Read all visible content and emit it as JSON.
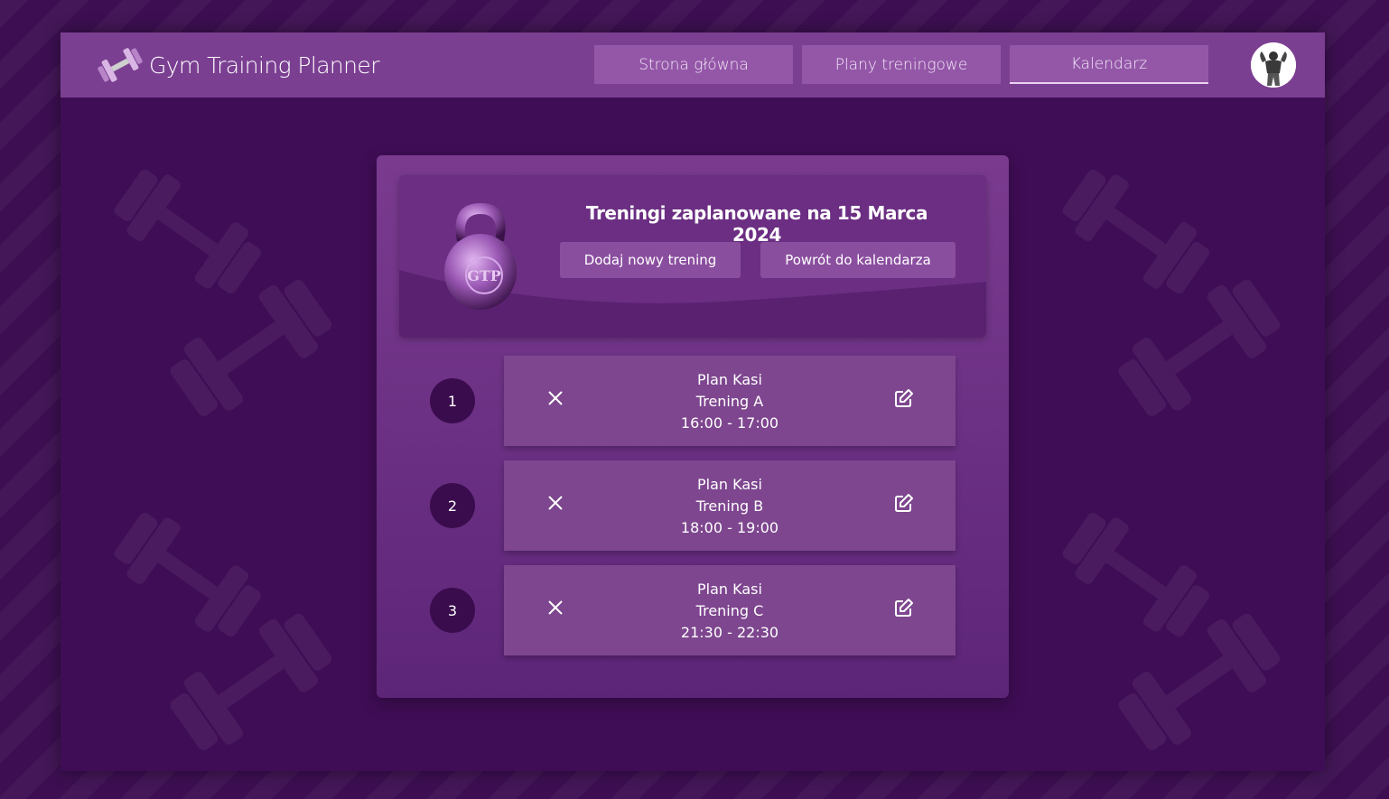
{
  "app": {
    "title": "Gym Training Planner",
    "logo_icon": "dumbbell-icon",
    "avatar_icon": "bodybuilder-avatar-icon"
  },
  "nav": {
    "items": [
      {
        "label": "Strona główna",
        "active": false
      },
      {
        "label": "Plany treningowe",
        "active": false
      },
      {
        "label": "Kalendarz",
        "active": true
      }
    ]
  },
  "day": {
    "title": "Treningi zaplanowane na 15 Marca 2024",
    "add_label": "Dodaj nowy trening",
    "back_label": "Powrót do kalendarza",
    "badge_icon": "kettlebell-gtp-icon",
    "badge_text": "GTP"
  },
  "trainings": [
    {
      "number": "1",
      "plan": "Plan Kasi",
      "name": "Trening A",
      "time": "16:00 - 17:00"
    },
    {
      "number": "2",
      "plan": "Plan Kasi",
      "name": "Trening B",
      "time": "18:00 - 19:00"
    },
    {
      "number": "3",
      "plan": "Plan Kasi",
      "name": "Trening C",
      "time": "21:30 - 22:30"
    }
  ],
  "colors": {
    "background": "#3d0f52",
    "header": "#7b3f92",
    "nav_button": "#9457a8",
    "panel": "#7a3b8f",
    "entry_card": "#7e468f",
    "number_badge": "#3a0c4d"
  }
}
